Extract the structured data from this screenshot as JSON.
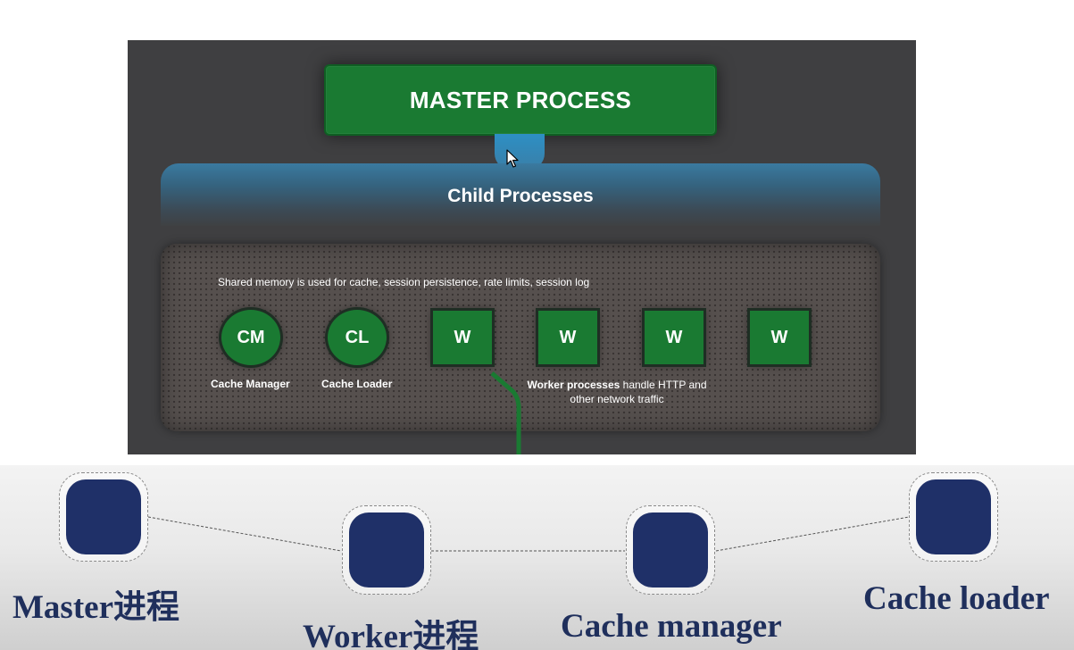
{
  "diagram": {
    "master_label": "MASTER PROCESS",
    "child_label": "Child Processes",
    "memory_note": "Shared memory is used for cache, session persistence, rate limits, session log",
    "nodes": [
      {
        "code": "CM",
        "label": "Cache Manager"
      },
      {
        "code": "CL",
        "label": "Cache Loader"
      },
      {
        "code": "W"
      },
      {
        "code": "W"
      },
      {
        "code": "W"
      },
      {
        "code": "W"
      }
    ],
    "worker_note_bold": "Worker processes",
    "worker_note_rest": " handle HTTP and other network traffic"
  },
  "slide": {
    "labels": [
      "Master进程",
      "Worker进程",
      "Cache manager",
      "Cache loader"
    ]
  },
  "colors": {
    "panel_bg": "#3f3f41",
    "process_green": "#1a7a32",
    "connector_blue": "#2d8fc4",
    "slide_node_navy": "#1f3068",
    "slide_label": "#1f2f5c"
  }
}
